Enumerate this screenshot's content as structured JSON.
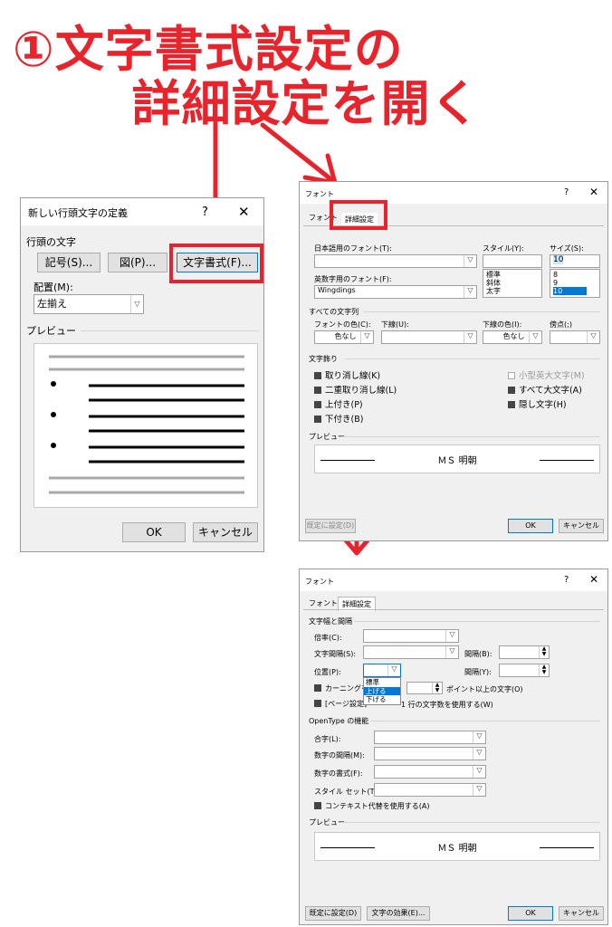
{
  "heading": {
    "line1": "①文字書式設定の",
    "line2": "詳細設定を開く"
  },
  "d1": {
    "title": "新しい行頭文字の定義",
    "help": "?",
    "close": "✕",
    "group_label": "行頭の文字",
    "symbol_button": "記号(S)...",
    "picture_button": "図(P)...",
    "font_button": "文字書式(F)...",
    "align_label": "配置(M):",
    "align_value": "左揃え",
    "preview_label": "プレビュー",
    "ok": "OK",
    "cancel": "キャンセル"
  },
  "d2": {
    "title": "フォント",
    "help": "?",
    "close": "✕",
    "tab_font": "フォント",
    "tab_advanced": "詳細設定",
    "jp_font_label": "日本語用のフォント(T):",
    "style_label": "スタイル(Y):",
    "size_label": "サイズ(S):",
    "style_value": "",
    "size_value": "10",
    "latin_font_label": "英数字用のフォント(F):",
    "latin_font_value": "Wingdings",
    "style_options": [
      "標準",
      "斜体",
      "太字"
    ],
    "size_options": [
      "8",
      "9",
      "10"
    ],
    "all_text_label": "すべての文字列",
    "font_color_label": "フォントの色(C):",
    "font_color_value": "色なし",
    "underline_label": "下線(U):",
    "underline_color_label": "下線の色(I):",
    "underline_color_value": "色なし",
    "emphasis_label": "傍点(;)",
    "effects_label": "文字飾り",
    "effects": [
      "取り消し線(K)",
      "二重取り消し線(L)",
      "上付き(P)",
      "下付き(B)"
    ],
    "effects_right": [
      "小型英大文字(M)",
      "すべて大文字(A)",
      "隠し文字(H)"
    ],
    "preview_label": "プレビュー",
    "preview_text": "ＭＳ 明朝",
    "default_button": "既定に設定(D)",
    "ok": "OK",
    "cancel": "キャンセル"
  },
  "d3": {
    "title": "フォント",
    "help": "?",
    "close": "✕",
    "tab_font": "フォント",
    "tab_advanced": "詳細設定",
    "spacing_section": "文字幅と間隔",
    "scale_label": "倍率(C):",
    "spacing_label": "文字間隔(S):",
    "spacing_by_label": "間隔(B):",
    "position_label": "位置(P):",
    "position_by_label": "間隔(Y):",
    "position_options": [
      "標準",
      "上げる",
      "下げる"
    ],
    "kerning_label": "カーニングを行",
    "kerning_suffix": "ポイント以上の文字(O)",
    "grid_label": "[ページ設定]",
    "grid_suffix": "1 行の文字数を使用する(W)",
    "opentype_section": "OpenType の機能",
    "ligatures_label": "合字(L):",
    "num_spacing_label": "数字の間隔(M):",
    "num_forms_label": "数字の書式(F):",
    "stylistic_label": "スタイル セット(T):",
    "contextual_label": "コンテキスト代替を使用する(A)",
    "preview_label": "プレビュー",
    "preview_text": "ＭＳ 明朝",
    "default_button": "既定に設定(D)",
    "effects_button": "文字の効果(E)...",
    "ok": "OK",
    "cancel": "キャンセル"
  },
  "colors": {
    "accent": "#e8232b",
    "dialog_bg": "#f0f0f0",
    "selection": "#0078d7"
  }
}
